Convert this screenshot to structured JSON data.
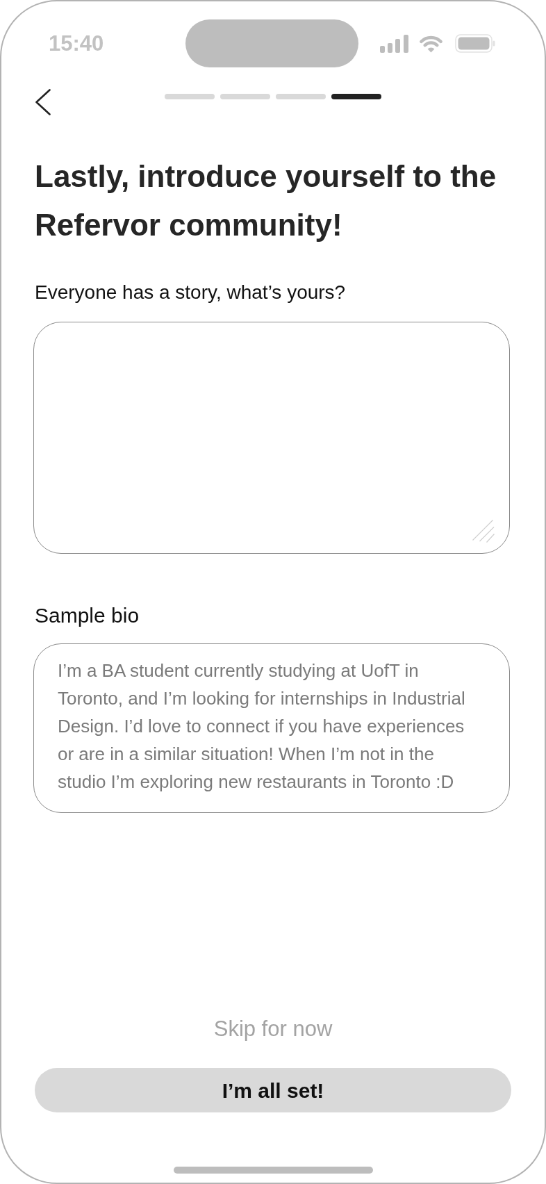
{
  "status_bar": {
    "time": "15:40"
  },
  "progress_steps": [
    {
      "selected": false
    },
    {
      "selected": false
    },
    {
      "selected": false
    },
    {
      "selected": true
    }
  ],
  "title": "Lastly, introduce yourself to the Refervor community!",
  "story_field": {
    "label": "Everyone has a story, what’s yours?"
  },
  "sample_bio": {
    "label": "Sample bio",
    "text": "I’m a BA student currently studying at UofT in Toronto, and I’m looking for internships in Industrial Design. I’d love to connect if you have experiences or are in a similar situation! When I’m not in the studio I’m exploring new restaurants in Toronto :D"
  },
  "skip_link": "Skip for now",
  "submit_button": "I’m all set!"
}
